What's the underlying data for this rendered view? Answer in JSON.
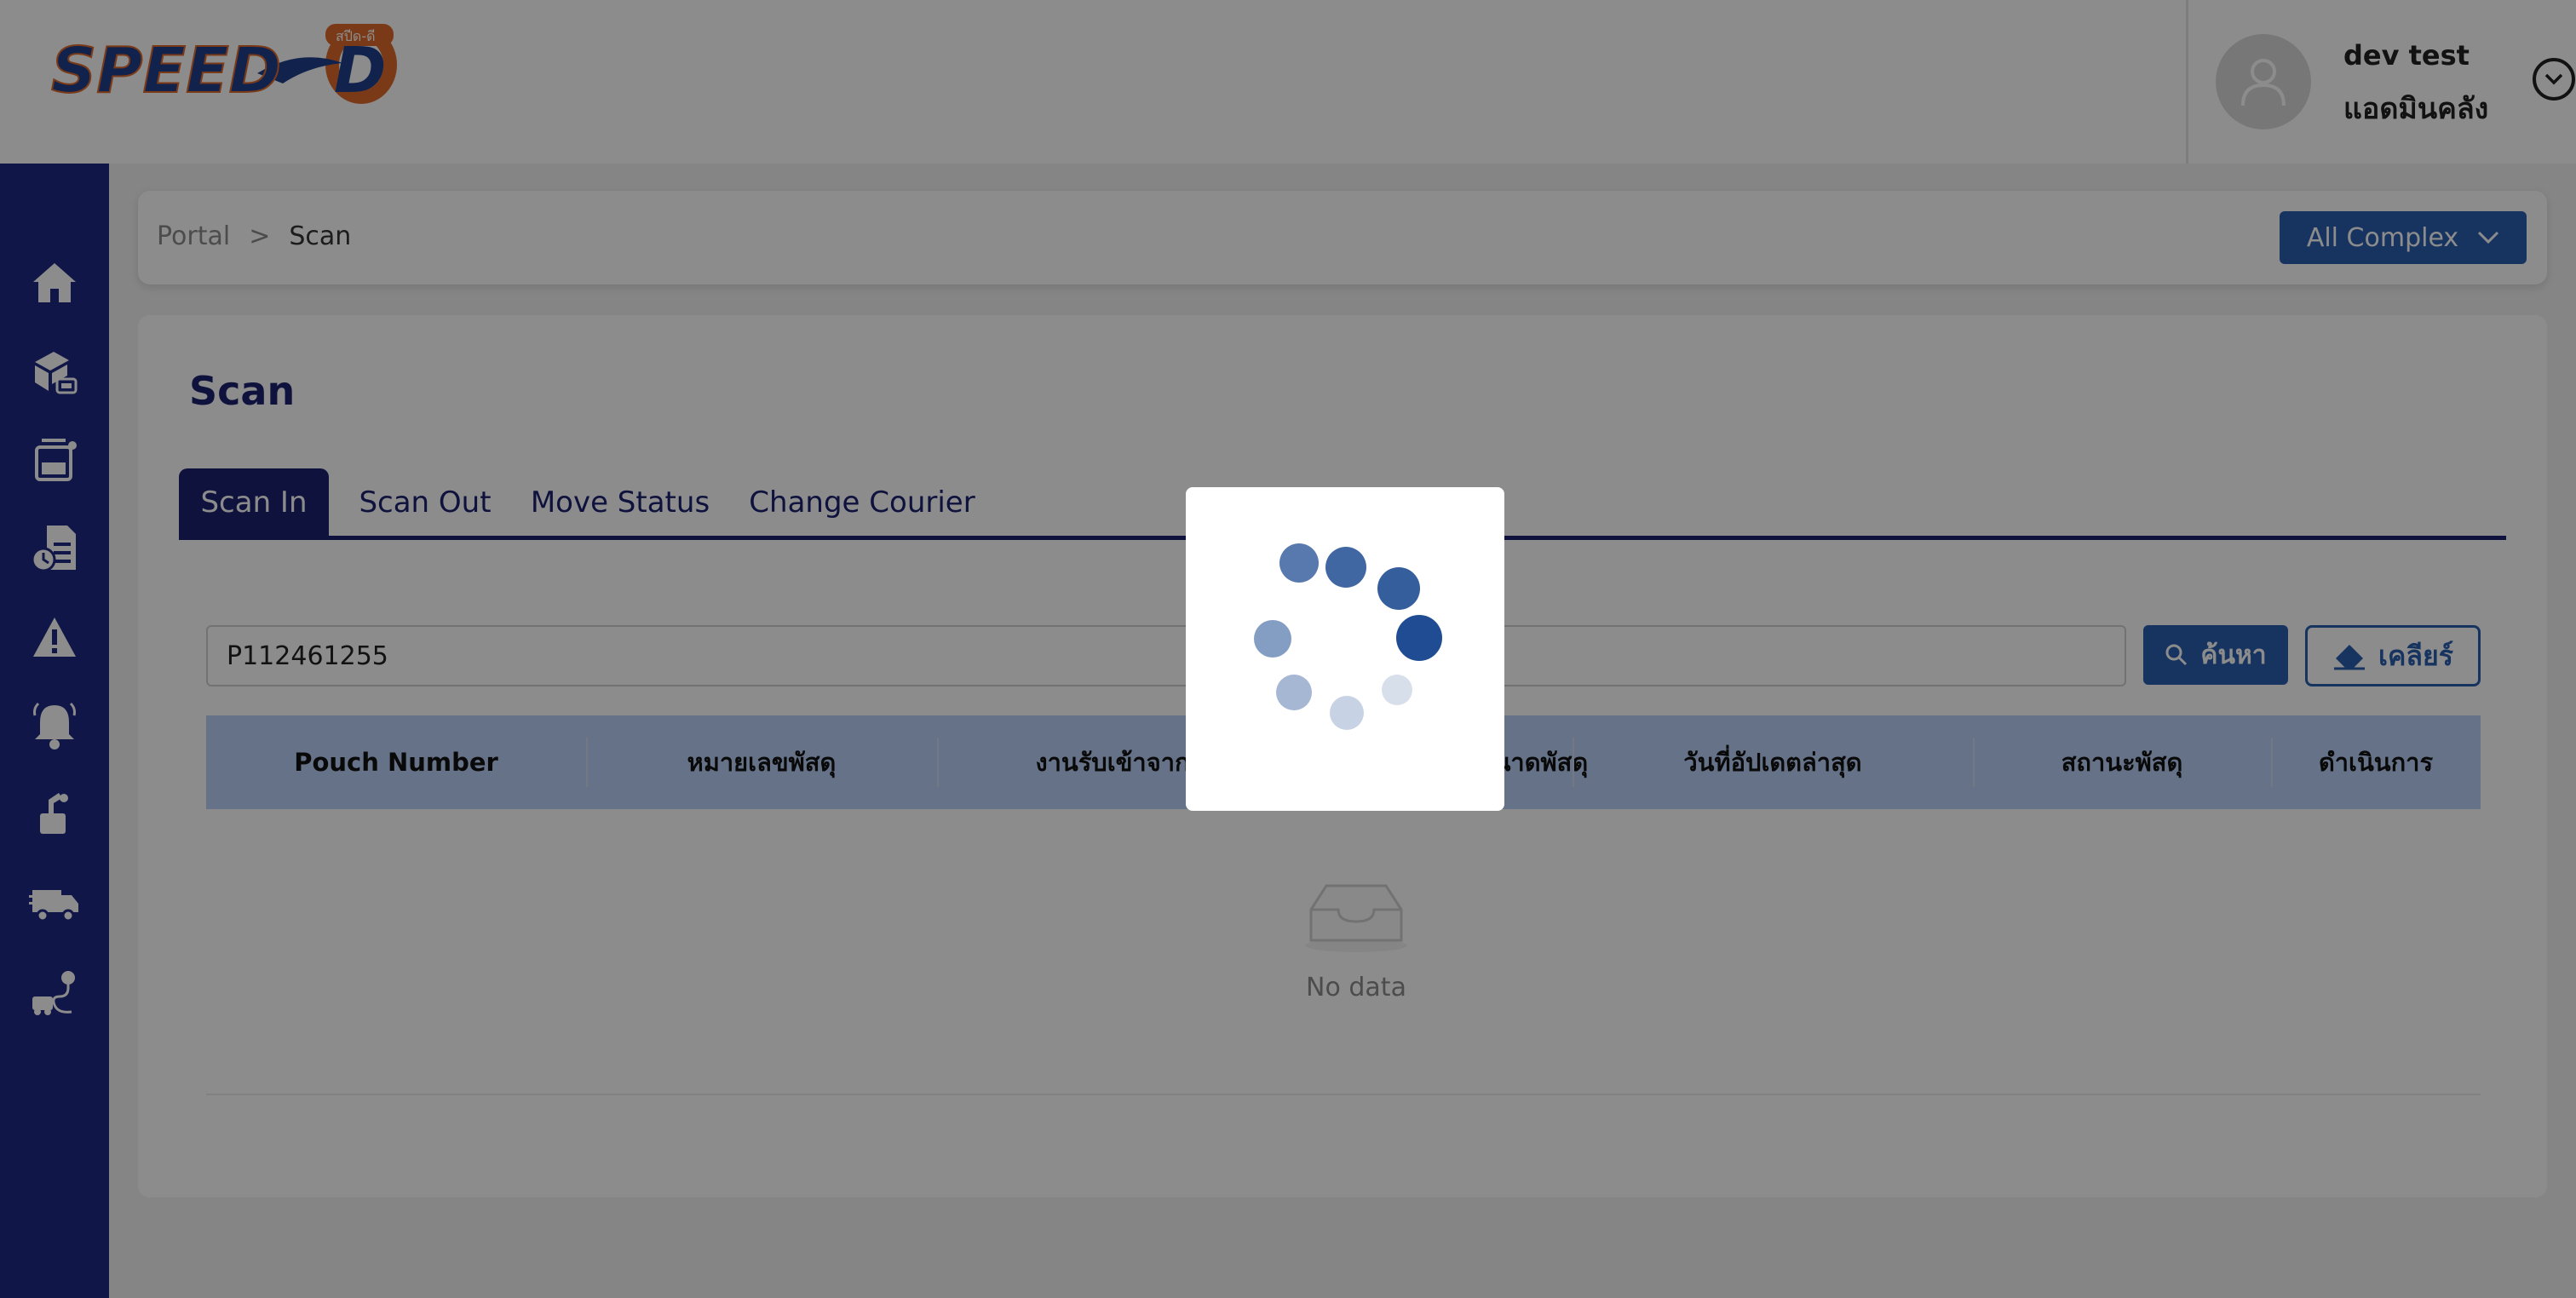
{
  "header": {
    "logo_text": "SPEED D",
    "logo_badge": "สปีด-ดี",
    "user": {
      "name": "dev test",
      "role": "แอดมินคลัง"
    }
  },
  "sidebar": {
    "items": [
      {
        "icon": "home-icon"
      },
      {
        "icon": "parcel-scan-icon"
      },
      {
        "icon": "inbox-tray-icon"
      },
      {
        "icon": "report-clock-icon"
      },
      {
        "icon": "warning-icon"
      },
      {
        "icon": "bell-icon"
      },
      {
        "icon": "pickup-icon"
      },
      {
        "icon": "truck-icon"
      },
      {
        "icon": "route-icon"
      }
    ]
  },
  "breadcrumb": {
    "root": "Portal",
    "separator": ">",
    "current": "Scan"
  },
  "complex_select": {
    "label": "All Complex"
  },
  "page": {
    "title": "Scan",
    "tabs": [
      {
        "label": "Scan In",
        "active": true
      },
      {
        "label": "Scan Out",
        "active": false
      },
      {
        "label": "Move Status",
        "active": false
      },
      {
        "label": "Change Courier",
        "active": false
      }
    ]
  },
  "search": {
    "value": "P112461255",
    "search_label": "ค้นหา",
    "clear_label": "เคลียร์"
  },
  "table": {
    "columns": [
      "Pouch Number",
      "หมายเลขพัสดุ",
      "งานรับเข้าจาก",
      "ขนาดพัสดุ",
      "วันที่อัปเดตล่าสุด",
      "สถานะพัสดุ",
      "ดำเนินการ"
    ],
    "empty_text": "No data"
  },
  "colors": {
    "primary": "#1a2170",
    "sidebar": "#1e2a84",
    "accent": "#2b5faf",
    "table_header": "#b8d0f6"
  },
  "loading": true
}
